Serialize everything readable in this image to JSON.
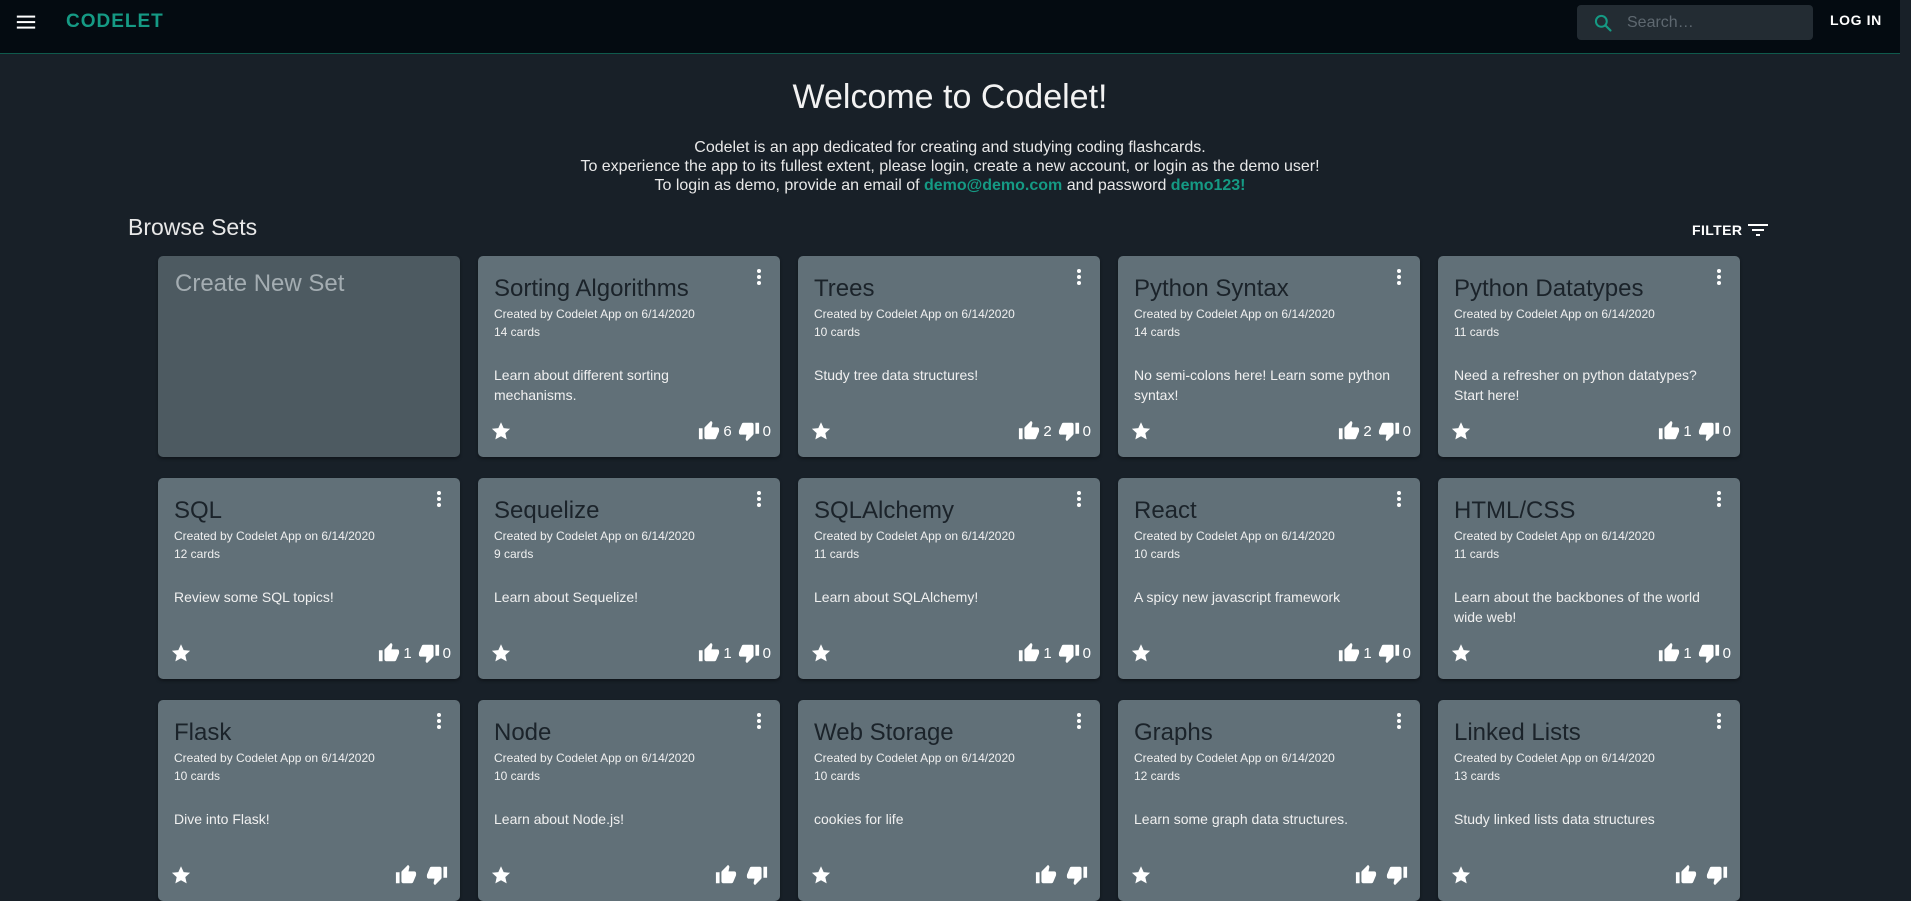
{
  "appbar": {
    "brand": "CODELET",
    "search_placeholder": "Search…",
    "login_label": "LOG IN",
    "icons": {
      "menu": "menu-icon",
      "search": "search-icon"
    }
  },
  "welcome": {
    "title": "Welcome to Codelet!",
    "line1": "Codelet is an app dedicated for creating and studying coding flashcards.",
    "line2": "To experience the app to its fullest extent, please login, create a new account, or login as the demo user!",
    "line3_prefix": "To login as demo, provide an email of ",
    "demo_email": "demo@demo.com",
    "line3_middle": " and password ",
    "demo_password": "demo123!"
  },
  "browse": {
    "title": "Browse Sets",
    "filter_label": "FILTER",
    "create_label": "Create New Set"
  },
  "colors": {
    "accent": "#159a84",
    "background": "#182028",
    "card": "#617078",
    "appbar": "#040b11"
  },
  "sets": [
    {
      "title": "Sorting Algorithms",
      "created": "Created by Codelet App on 6/14/2020",
      "cards": "14 cards",
      "description": "Learn about different sorting mechanisms.",
      "likes": "6",
      "dislikes": "0"
    },
    {
      "title": "Trees",
      "created": "Created by Codelet App on 6/14/2020",
      "cards": "10 cards",
      "description": "Study tree data structures!",
      "likes": "2",
      "dislikes": "0"
    },
    {
      "title": "Python Syntax",
      "created": "Created by Codelet App on 6/14/2020",
      "cards": "14 cards",
      "description": "No semi-colons here! Learn some python syntax!",
      "likes": "2",
      "dislikes": "0"
    },
    {
      "title": "Python Datatypes",
      "created": "Created by Codelet App on 6/14/2020",
      "cards": "11 cards",
      "description": "Need a refresher on python datatypes? Start here!",
      "likes": "1",
      "dislikes": "0"
    },
    {
      "title": "SQL",
      "created": "Created by Codelet App on 6/14/2020",
      "cards": "12 cards",
      "description": "Review some SQL topics!",
      "likes": "1",
      "dislikes": "0"
    },
    {
      "title": "Sequelize",
      "created": "Created by Codelet App on 6/14/2020",
      "cards": "9 cards",
      "description": "Learn about Sequelize!",
      "likes": "1",
      "dislikes": "0"
    },
    {
      "title": "SQLAlchemy",
      "created": "Created by Codelet App on 6/14/2020",
      "cards": "11 cards",
      "description": "Learn about SQLAlchemy!",
      "likes": "1",
      "dislikes": "0"
    },
    {
      "title": "React",
      "created": "Created by Codelet App on 6/14/2020",
      "cards": "10 cards",
      "description": "A spicy new javascript framework",
      "likes": "1",
      "dislikes": "0"
    },
    {
      "title": "HTML/CSS",
      "created": "Created by Codelet App on 6/14/2020",
      "cards": "11 cards",
      "description": "Learn about the backbones of the world wide web!",
      "likes": "1",
      "dislikes": "0"
    },
    {
      "title": "Flask",
      "created": "Created by Codelet App on 6/14/2020",
      "cards": "10 cards",
      "description": "Dive into Flask!",
      "likes": "",
      "dislikes": ""
    },
    {
      "title": "Node",
      "created": "Created by Codelet App on 6/14/2020",
      "cards": "10 cards",
      "description": "Learn about Node.js!",
      "likes": "",
      "dislikes": ""
    },
    {
      "title": "Web Storage",
      "created": "Created by Codelet App on 6/14/2020",
      "cards": "10 cards",
      "description": "cookies for life",
      "likes": "",
      "dislikes": ""
    },
    {
      "title": "Graphs",
      "created": "Created by Codelet App on 6/14/2020",
      "cards": "12 cards",
      "description": "Learn some graph data structures.",
      "likes": "",
      "dislikes": ""
    },
    {
      "title": "Linked Lists",
      "created": "Created by Codelet App on 6/14/2020",
      "cards": "13 cards",
      "description": "Study linked lists data structures",
      "likes": "",
      "dislikes": ""
    }
  ]
}
